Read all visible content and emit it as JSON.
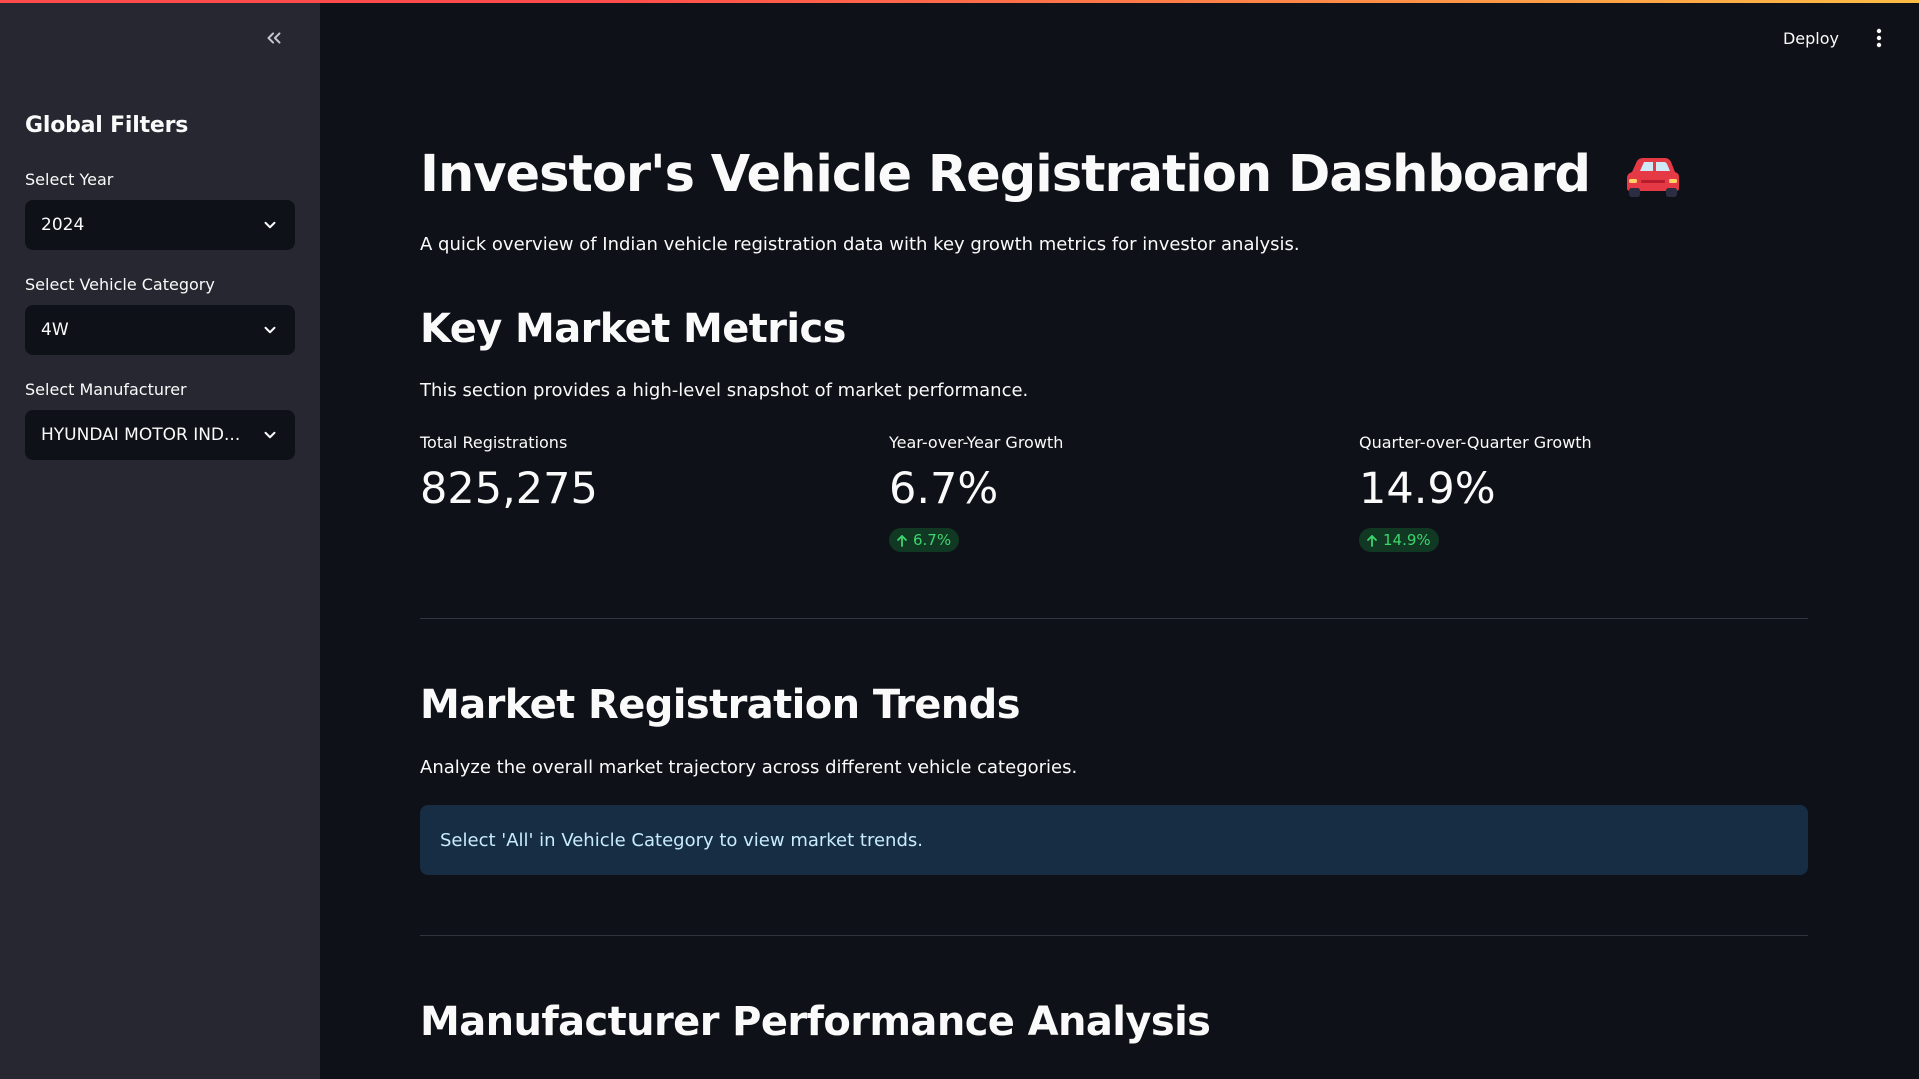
{
  "sidebar": {
    "title": "Global Filters",
    "filters": [
      {
        "label": "Select Year",
        "value": "2024"
      },
      {
        "label": "Select Vehicle Category",
        "value": "4W"
      },
      {
        "label": "Select Manufacturer",
        "value": "HYUNDAI MOTOR IND..."
      }
    ]
  },
  "header": {
    "deploy_label": "Deploy"
  },
  "main": {
    "title": "Investor's Vehicle Registration Dashboard",
    "subtitle": "A quick overview of Indian vehicle registration data with key growth metrics for investor analysis.",
    "sections": [
      {
        "heading": "Key Market Metrics",
        "text": "This section provides a high-level snapshot of market performance."
      },
      {
        "heading": "Market Registration Trends",
        "text": "Analyze the overall market trajectory across different vehicle categories."
      },
      {
        "heading": "Manufacturer Performance Analysis"
      }
    ],
    "metrics": [
      {
        "label": "Total Registrations",
        "value": "825,275"
      },
      {
        "label": "Year-over-Year Growth",
        "value": "6.7%",
        "delta": "6.7%"
      },
      {
        "label": "Quarter-over-Quarter Growth",
        "value": "14.9%",
        "delta": "14.9%"
      }
    ],
    "info_message": "Select 'All' in Vehicle Category to view market trends."
  },
  "colors": {
    "background": "#0e1117",
    "sidebar": "#262730",
    "positive_delta": "#3dd56d",
    "info_bg": "#172d43",
    "accent_red": "#ff4b4b",
    "accent_yellow": "#ffbd45"
  },
  "icons": {
    "collapse": "double-chevron-left-icon",
    "dropdown": "chevron-down-icon",
    "menu": "kebab-menu-icon",
    "title_emoji": "red-car-icon",
    "delta": "arrow-up-icon"
  }
}
